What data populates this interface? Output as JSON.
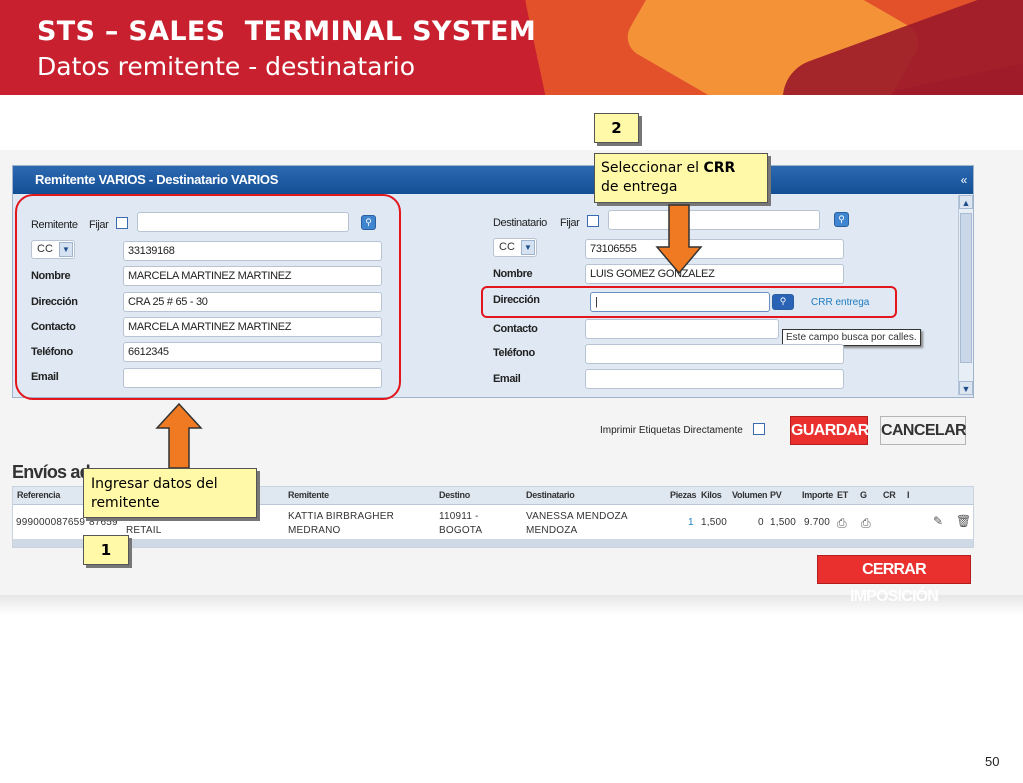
{
  "slide": {
    "title": "STS – SALES  TERMINAL SYSTEM",
    "subtitle": "Datos remitente - destinatario",
    "page_number": "50"
  },
  "panel": {
    "header": "Remitente VARIOS - Destinatario VARIOS",
    "collapse": "«"
  },
  "remitente": {
    "label": "Remitente",
    "fijar": "Fijar",
    "doc_type": "CC",
    "doc_number": "33139168",
    "nombre_label": "Nombre",
    "nombre": "MARCELA MARTINEZ MARTINEZ",
    "direccion_label": "Dirección",
    "direccion": "CRA 25 # 65 - 30",
    "contacto_label": "Contacto",
    "contacto": "MARCELA MARTINEZ MARTINEZ",
    "telefono_label": "Teléfono",
    "telefono": "6612345",
    "email_label": "Email",
    "email": ""
  },
  "destinatario": {
    "label": "Destinatario",
    "fijar": "Fijar",
    "doc_type": "CC",
    "doc_number": "73106555",
    "nombre_label": "Nombre",
    "nombre": "LUIS GOMEZ GONZALEZ",
    "direccion_label": "Dirección",
    "direccion": "|",
    "crr_link": "CRR entrega",
    "tooltip": "Este campo busca por calles.",
    "contacto_label": "Contacto",
    "telefono_label": "Teléfono",
    "email_label": "Email"
  },
  "actions": {
    "print_label": "Imprimir Etiquetas Directamente",
    "guardar": "GUARDAR",
    "cancelar": "CANCELAR",
    "cerrar": "CERRAR IMPOSICIÓN"
  },
  "envios": {
    "title": "Envíos ad",
    "columns": [
      "Referencia",
      "Remitente",
      "Destino",
      "Destinatario",
      "Piezas",
      "Kilos",
      "Volumen",
      "PV",
      "Importe",
      "ET",
      "G",
      "CR",
      "I"
    ],
    "row": {
      "referencia": "999000087659",
      "referencia2": "87659",
      "tipo": "RETAIL",
      "remitente_1": "KATTIA BIRBRAGHER",
      "remitente_2": "MEDRANO",
      "destino_1": "110911 -",
      "destino_2": "BOGOTA",
      "destinatario_1": "VANESSA MENDOZA",
      "destinatario_2": "MENDOZA",
      "piezas": "1",
      "kilos": "1,500",
      "volumen": "0",
      "pv": "1,500",
      "importe": "9.700"
    }
  },
  "callouts": {
    "c1_number": "1",
    "c1_text_1": "Ingresar datos del",
    "c1_text_2": "remitente",
    "c2_number": "2",
    "c2_text_1": "Seleccionar el ",
    "c2_bold": "CRR",
    "c2_text_2": "de entrega"
  },
  "colors": {
    "header_red": "#c8202f",
    "panel_blue": "#134f95",
    "button_red": "#e9302e",
    "callout_yellow": "#fff9a8",
    "arrow_orange": "#f07a22",
    "highlight_red": "#e3161d"
  }
}
